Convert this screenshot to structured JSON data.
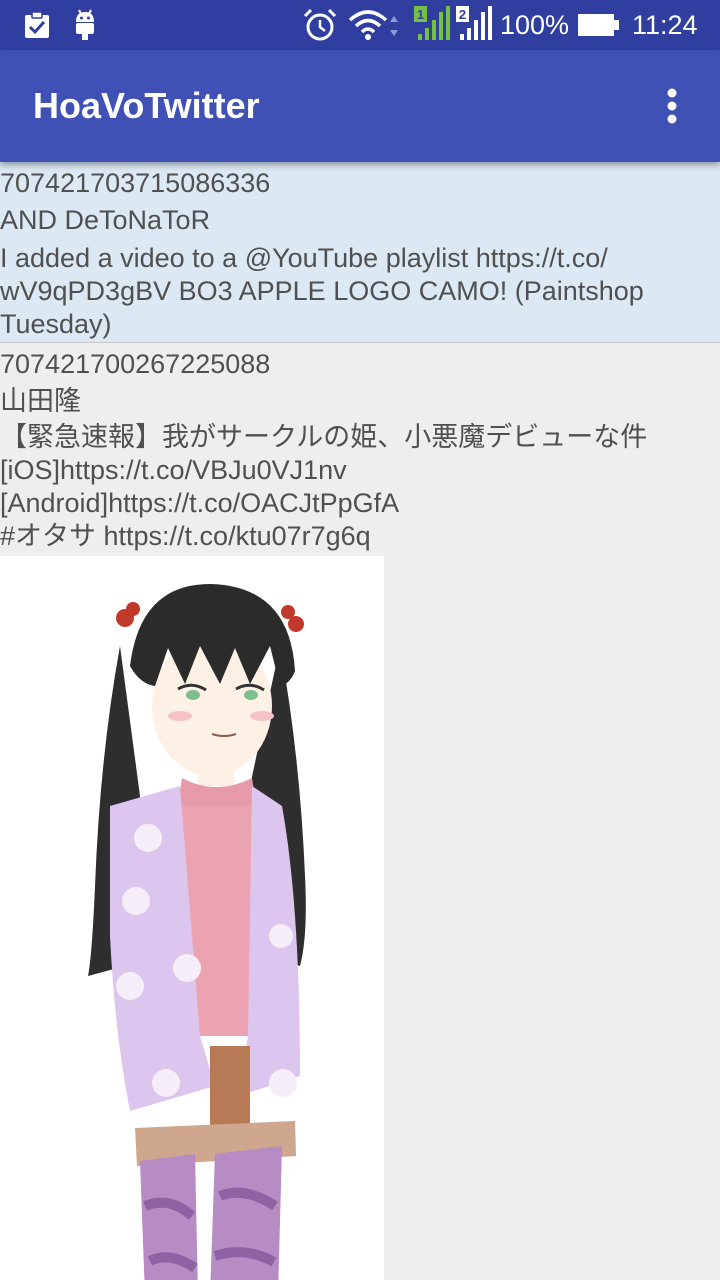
{
  "status_bar": {
    "battery": "100%",
    "time": "11:24",
    "sim1": "1",
    "sim2": "2"
  },
  "app_bar": {
    "title": "HoaVoTwitter"
  },
  "tweets": [
    {
      "id": "707421703715086336",
      "user": "AND DeToNaToR",
      "text": "I added a video to a @YouTube playlist https://t.co/\nwV9qPD3gBV BO3 APPLE LOGO CAMO! (Paintshop\nTuesday)"
    },
    {
      "id": "707421700267225088",
      "user": "山田隆",
      "text": "【緊急速報】我がサークルの姫、小悪魔デビューな件\n[iOS]https://t.co/VBJu0VJ1nv\n[Android]https://t.co/OACJtPpGfA\n#オタサ https://t.co/ktu07r7g6q"
    }
  ],
  "colors": {
    "status_bar": "#303f9f",
    "app_bar": "#3f51b5",
    "highlight_row": "#dce8f4",
    "background": "#eeeeee"
  }
}
